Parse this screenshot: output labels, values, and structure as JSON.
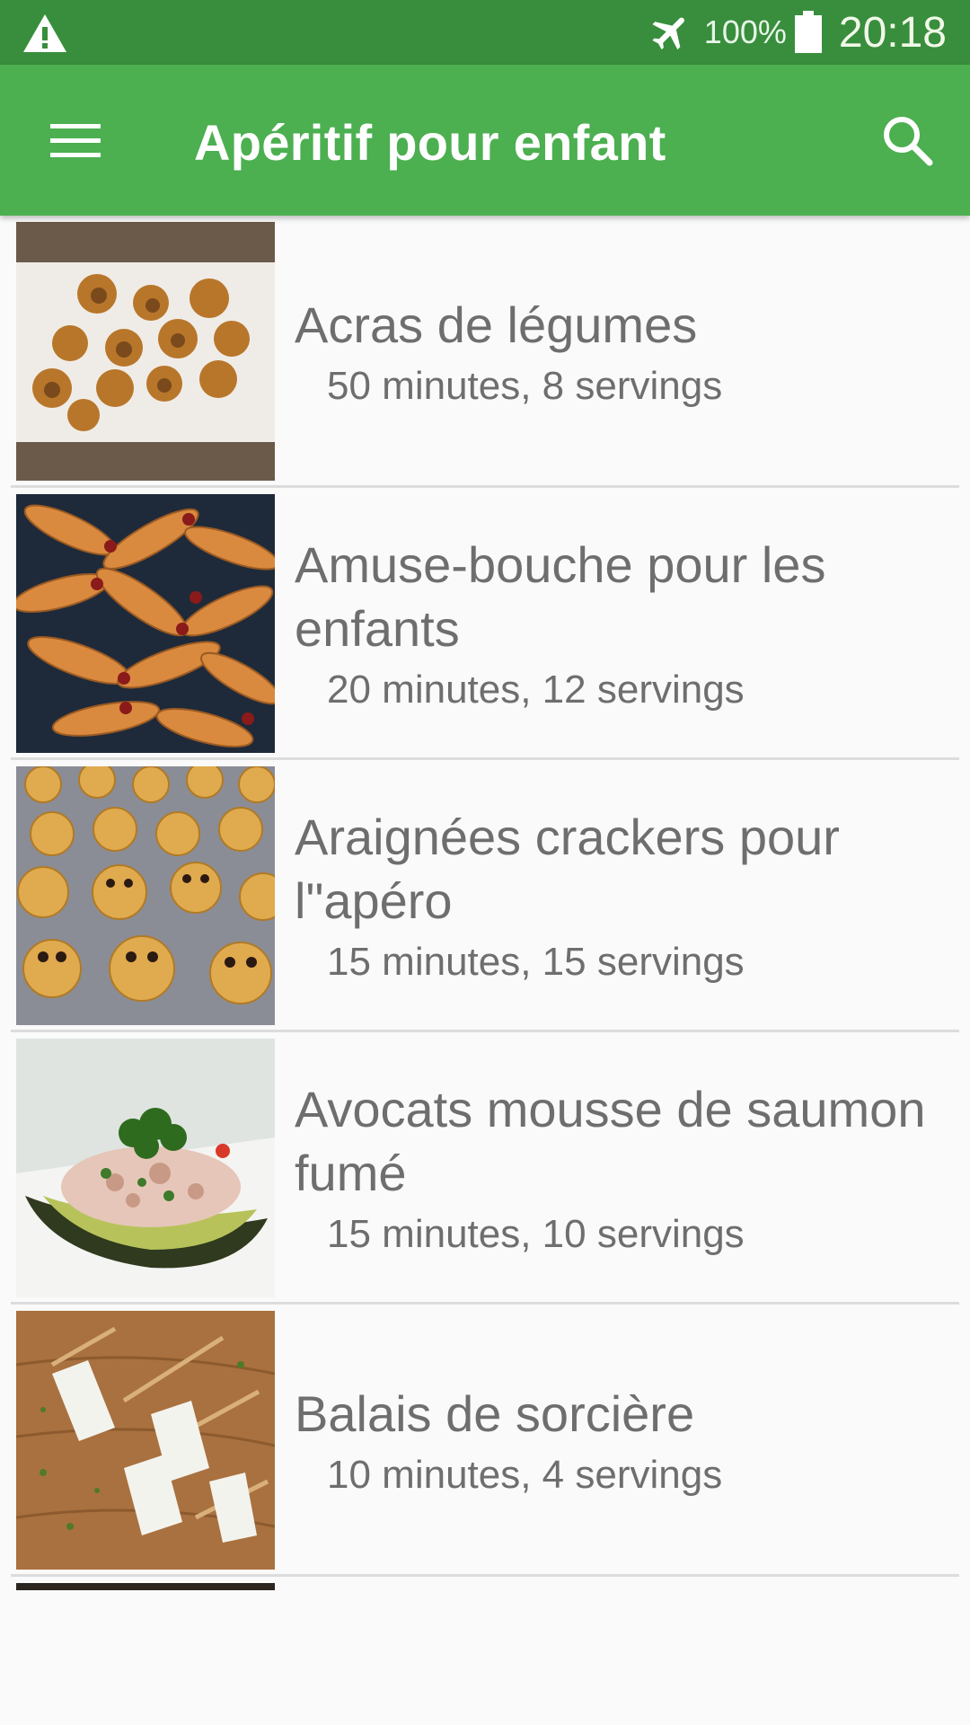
{
  "status_bar": {
    "battery_percent": "100%",
    "time": "20:18",
    "icons": [
      "warning-icon",
      "airplane-mode-icon",
      "battery-icon"
    ]
  },
  "app_bar": {
    "title": "Apéritif pour enfant",
    "menu_icon": "hamburger-menu-icon",
    "search_icon": "search-icon"
  },
  "recipes": [
    {
      "title": "Acras de légumes",
      "meta": "50 minutes, 8 servings"
    },
    {
      "title": "Amuse-bouche pour les enfants",
      "meta": "20 minutes, 12 servings"
    },
    {
      "title": "Araignées crackers pour l\"apéro",
      "meta": "15 minutes, 15 servings"
    },
    {
      "title": "Avocats mousse de saumon fumé",
      "meta": "15 minutes, 10 servings"
    },
    {
      "title": "Balais de sorcière",
      "meta": "10 minutes, 4 servings"
    }
  ],
  "colors": {
    "status_bar": "#388e3c",
    "app_bar": "#4caf50",
    "background": "#fafafa",
    "text": "#6e6e6e",
    "divider": "#dcdcdc"
  }
}
